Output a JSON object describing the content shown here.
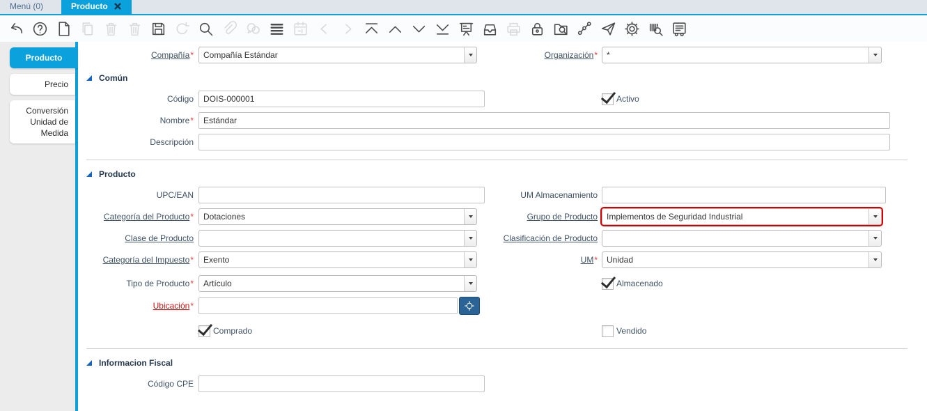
{
  "window_tabs": {
    "menu": "Menú (0)",
    "producto": "Producto"
  },
  "ui": {
    "required_marker": "*"
  },
  "colors": {
    "accent": "#0aa1dc",
    "error_highlight": "#d40000",
    "locator_button": "#2a6496",
    "required": "#e53935"
  },
  "toolbar": {
    "icons": [
      {
        "name": "undo-icon",
        "enabled": true
      },
      {
        "name": "help-icon",
        "enabled": true
      },
      {
        "name": "new-record-icon",
        "enabled": true
      },
      {
        "name": "copy-record-icon",
        "enabled": false
      },
      {
        "name": "delete-record-icon",
        "enabled": false
      },
      {
        "name": "delete-selection-icon",
        "enabled": false
      },
      {
        "name": "save-icon",
        "enabled": true
      },
      {
        "name": "refresh-icon",
        "enabled": false
      },
      {
        "name": "find-icon",
        "enabled": true
      },
      {
        "name": "attachment-icon",
        "enabled": false
      },
      {
        "name": "chat-icon",
        "enabled": false
      },
      {
        "name": "grid-toggle-icon",
        "enabled": true
      },
      {
        "name": "calendar-icon",
        "enabled": false
      },
      {
        "name": "parent-record-icon",
        "enabled": false
      },
      {
        "name": "detail-record-icon",
        "enabled": false
      },
      {
        "name": "first-record-icon",
        "enabled": true
      },
      {
        "name": "previous-record-icon",
        "enabled": true
      },
      {
        "name": "next-record-icon",
        "enabled": true
      },
      {
        "name": "last-record-icon",
        "enabled": true
      },
      {
        "name": "report-icon",
        "enabled": true
      },
      {
        "name": "archive-icon",
        "enabled": true
      },
      {
        "name": "print-icon",
        "enabled": false
      },
      {
        "name": "lock-icon",
        "enabled": true
      },
      {
        "name": "zoom-across-icon",
        "enabled": true
      },
      {
        "name": "workflow-icon",
        "enabled": true
      },
      {
        "name": "requests-icon",
        "enabled": true
      },
      {
        "name": "preferences-icon",
        "enabled": true
      },
      {
        "name": "product-info-icon",
        "enabled": true
      },
      {
        "name": "report-list-icon",
        "enabled": true
      }
    ]
  },
  "sidebar": {
    "producto": "Producto",
    "precio": "Precio",
    "conversion": "Conversión Unidad de Medida"
  },
  "form": {
    "compania_label": "Compañía",
    "compania_value": "Compañía Estándar",
    "organizacion_label": "Organización",
    "organizacion_value": "*",
    "comun_title": "Común",
    "codigo_label": "Código",
    "codigo_value": "DOIS-000001",
    "activo_label": "Activo",
    "activo_checked": true,
    "nombre_label": "Nombre",
    "nombre_value": "Estándar",
    "descripcion_label": "Descripción",
    "descripcion_value": "",
    "producto_title": "Producto",
    "upc_label": "UPC/EAN",
    "upc_value": "",
    "um_almacenamiento_label": "UM Almacenamiento",
    "um_almacenamiento_value": "",
    "categoria_producto_label": "Categoría del Producto",
    "categoria_producto_value": "Dotaciones",
    "grupo_producto_label": "Grupo de Producto",
    "grupo_producto_value": "Implementos de Seguridad Industrial",
    "clase_producto_label": "Clase de Producto",
    "clase_producto_value": "",
    "clasificacion_producto_label": "Clasificación de Producto",
    "clasificacion_producto_value": "",
    "categoria_impuesto_label": "Categoría del Impuesto",
    "categoria_impuesto_value": "Exento",
    "um_label": "UM",
    "um_value": "Unidad",
    "tipo_producto_label": "Tipo de Producto",
    "tipo_producto_value": "Artículo",
    "almacenado_label": "Almacenado",
    "almacenado_checked": true,
    "ubicacion_label": "Ubicación",
    "ubicacion_value": "",
    "comprado_label": "Comprado",
    "comprado_checked": true,
    "vendido_label": "Vendido",
    "vendido_checked": false,
    "fiscal_title": "Informacion Fiscal",
    "codigo_cpe_label": "Código CPE",
    "codigo_cpe_value": ""
  }
}
